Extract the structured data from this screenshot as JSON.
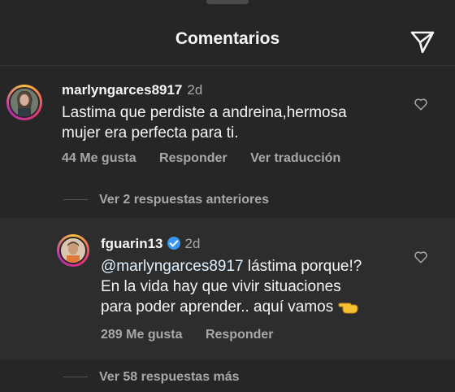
{
  "header": {
    "title": "Comentarios",
    "share_icon": "send-icon"
  },
  "comments": [
    {
      "username": "marlyngarces8917",
      "time": "2d",
      "lines": [
        "Lastima que perdiste a andreina,hermosa",
        "mujer era perfecta para ti."
      ],
      "likes": "44 Me gusta",
      "reply": "Responder",
      "translate": "Ver traducción"
    }
  ],
  "view_previous": "Ver 2 respuestas anteriores",
  "reply": {
    "username": "fguarin13",
    "time": "2d",
    "mention": "@marlyngarces8917",
    "line1_rest": " lástima porque!?",
    "line2": "En la vida hay que vivir situaciones",
    "line3": "para poder aprender.. aquí vamos",
    "likes": "289 Me gusta",
    "reply_label": "Responder"
  },
  "view_more": "Ver 58 respuestas más",
  "colors": {
    "background": "#262626",
    "highlight": "#2d2d2d",
    "muted": "#a8a8a8",
    "verified": "#3897f0"
  }
}
